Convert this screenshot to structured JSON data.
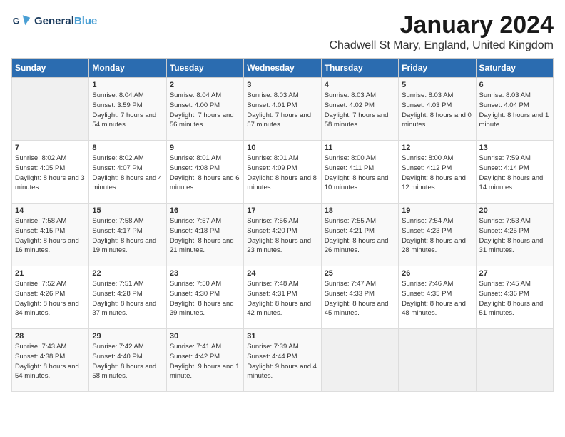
{
  "logo": {
    "line1": "General",
    "line2": "Blue"
  },
  "title": "January 2024",
  "subtitle": "Chadwell St Mary, England, United Kingdom",
  "days_of_week": [
    "Sunday",
    "Monday",
    "Tuesday",
    "Wednesday",
    "Thursday",
    "Friday",
    "Saturday"
  ],
  "weeks": [
    [
      {
        "day": "",
        "sunrise": "",
        "sunset": "",
        "daylight": "",
        "empty": true
      },
      {
        "day": "1",
        "sunrise": "8:04 AM",
        "sunset": "3:59 PM",
        "daylight": "7 hours and 54 minutes."
      },
      {
        "day": "2",
        "sunrise": "8:04 AM",
        "sunset": "4:00 PM",
        "daylight": "7 hours and 56 minutes."
      },
      {
        "day": "3",
        "sunrise": "8:03 AM",
        "sunset": "4:01 PM",
        "daylight": "7 hours and 57 minutes."
      },
      {
        "day": "4",
        "sunrise": "8:03 AM",
        "sunset": "4:02 PM",
        "daylight": "7 hours and 58 minutes."
      },
      {
        "day": "5",
        "sunrise": "8:03 AM",
        "sunset": "4:03 PM",
        "daylight": "8 hours and 0 minutes."
      },
      {
        "day": "6",
        "sunrise": "8:03 AM",
        "sunset": "4:04 PM",
        "daylight": "8 hours and 1 minute."
      }
    ],
    [
      {
        "day": "7",
        "sunrise": "8:02 AM",
        "sunset": "4:05 PM",
        "daylight": "8 hours and 3 minutes."
      },
      {
        "day": "8",
        "sunrise": "8:02 AM",
        "sunset": "4:07 PM",
        "daylight": "8 hours and 4 minutes."
      },
      {
        "day": "9",
        "sunrise": "8:01 AM",
        "sunset": "4:08 PM",
        "daylight": "8 hours and 6 minutes."
      },
      {
        "day": "10",
        "sunrise": "8:01 AM",
        "sunset": "4:09 PM",
        "daylight": "8 hours and 8 minutes."
      },
      {
        "day": "11",
        "sunrise": "8:00 AM",
        "sunset": "4:11 PM",
        "daylight": "8 hours and 10 minutes."
      },
      {
        "day": "12",
        "sunrise": "8:00 AM",
        "sunset": "4:12 PM",
        "daylight": "8 hours and 12 minutes."
      },
      {
        "day": "13",
        "sunrise": "7:59 AM",
        "sunset": "4:14 PM",
        "daylight": "8 hours and 14 minutes."
      }
    ],
    [
      {
        "day": "14",
        "sunrise": "7:58 AM",
        "sunset": "4:15 PM",
        "daylight": "8 hours and 16 minutes."
      },
      {
        "day": "15",
        "sunrise": "7:58 AM",
        "sunset": "4:17 PM",
        "daylight": "8 hours and 19 minutes."
      },
      {
        "day": "16",
        "sunrise": "7:57 AM",
        "sunset": "4:18 PM",
        "daylight": "8 hours and 21 minutes."
      },
      {
        "day": "17",
        "sunrise": "7:56 AM",
        "sunset": "4:20 PM",
        "daylight": "8 hours and 23 minutes."
      },
      {
        "day": "18",
        "sunrise": "7:55 AM",
        "sunset": "4:21 PM",
        "daylight": "8 hours and 26 minutes."
      },
      {
        "day": "19",
        "sunrise": "7:54 AM",
        "sunset": "4:23 PM",
        "daylight": "8 hours and 28 minutes."
      },
      {
        "day": "20",
        "sunrise": "7:53 AM",
        "sunset": "4:25 PM",
        "daylight": "8 hours and 31 minutes."
      }
    ],
    [
      {
        "day": "21",
        "sunrise": "7:52 AM",
        "sunset": "4:26 PM",
        "daylight": "8 hours and 34 minutes."
      },
      {
        "day": "22",
        "sunrise": "7:51 AM",
        "sunset": "4:28 PM",
        "daylight": "8 hours and 37 minutes."
      },
      {
        "day": "23",
        "sunrise": "7:50 AM",
        "sunset": "4:30 PM",
        "daylight": "8 hours and 39 minutes."
      },
      {
        "day": "24",
        "sunrise": "7:48 AM",
        "sunset": "4:31 PM",
        "daylight": "8 hours and 42 minutes."
      },
      {
        "day": "25",
        "sunrise": "7:47 AM",
        "sunset": "4:33 PM",
        "daylight": "8 hours and 45 minutes."
      },
      {
        "day": "26",
        "sunrise": "7:46 AM",
        "sunset": "4:35 PM",
        "daylight": "8 hours and 48 minutes."
      },
      {
        "day": "27",
        "sunrise": "7:45 AM",
        "sunset": "4:36 PM",
        "daylight": "8 hours and 51 minutes."
      }
    ],
    [
      {
        "day": "28",
        "sunrise": "7:43 AM",
        "sunset": "4:38 PM",
        "daylight": "8 hours and 54 minutes."
      },
      {
        "day": "29",
        "sunrise": "7:42 AM",
        "sunset": "4:40 PM",
        "daylight": "8 hours and 58 minutes."
      },
      {
        "day": "30",
        "sunrise": "7:41 AM",
        "sunset": "4:42 PM",
        "daylight": "9 hours and 1 minute."
      },
      {
        "day": "31",
        "sunrise": "7:39 AM",
        "sunset": "4:44 PM",
        "daylight": "9 hours and 4 minutes."
      },
      {
        "day": "",
        "sunrise": "",
        "sunset": "",
        "daylight": "",
        "empty": true
      },
      {
        "day": "",
        "sunrise": "",
        "sunset": "",
        "daylight": "",
        "empty": true
      },
      {
        "day": "",
        "sunrise": "",
        "sunset": "",
        "daylight": "",
        "empty": true
      }
    ]
  ],
  "labels": {
    "sunrise": "Sunrise:",
    "sunset": "Sunset:",
    "daylight": "Daylight:"
  }
}
